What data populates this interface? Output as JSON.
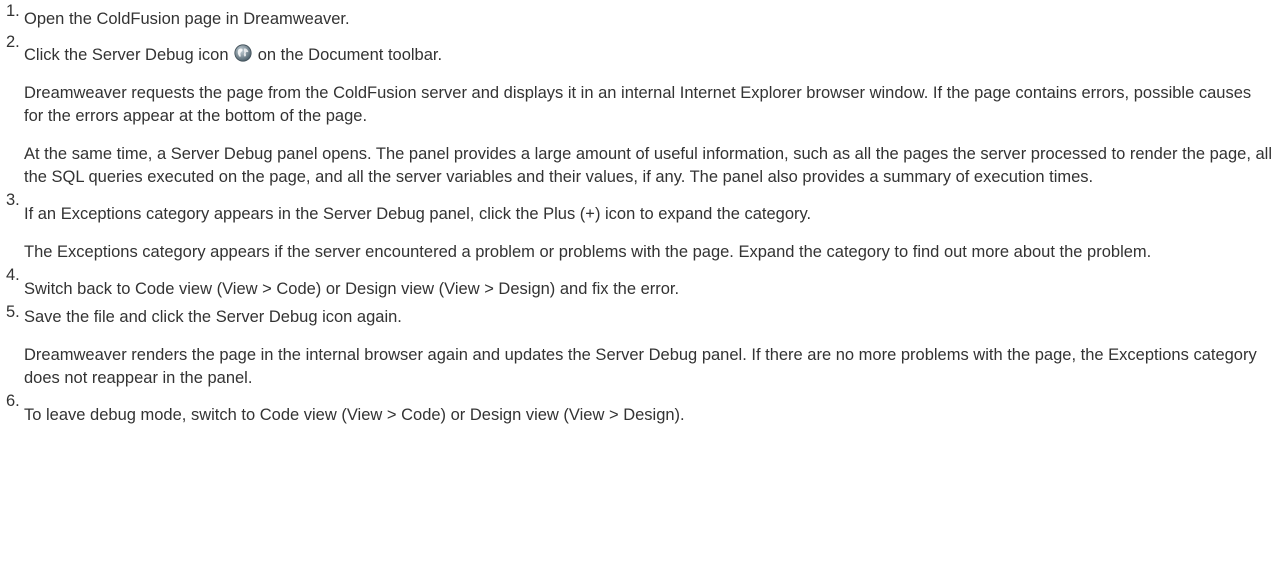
{
  "steps": [
    {
      "number": "1.",
      "text": "Open the ColdFusion page in Dreamweaver."
    },
    {
      "number": "2.",
      "text_before_icon": "Click the Server Debug icon",
      "icon": "server-debug-globe-icon",
      "text_after_icon": "on the Document toolbar.",
      "paragraphs": [
        "Dreamweaver requests the page from the ColdFusion server and displays it in an internal Internet Explorer browser window. If the page contains errors, possible causes for the errors appear at the bottom of the page.",
        "At the same time, a Server Debug panel opens. The panel provides a large amount of useful information, such as all the pages the server processed to render the page, all the SQL queries executed on the page, and all the server variables and their values, if any. The panel also provides a summary of execution times."
      ]
    },
    {
      "number": "3.",
      "text": "If an Exceptions category appears in the Server Debug panel, click the Plus (+) icon to expand the category.",
      "paragraphs": [
        "The Exceptions category appears if the server encountered a problem or problems with the page. Expand the category to find out more about the problem."
      ]
    },
    {
      "number": "4.",
      "text": "Switch back to Code view (View > Code) or Design view (View > Design) and fix the error."
    },
    {
      "number": "5.",
      "text": "Save the file and click the Server Debug icon again.",
      "paragraphs": [
        "Dreamweaver renders the page in the internal browser again and updates the Server Debug panel. If there are no more problems with the page, the Exceptions category does not reappear in the panel."
      ]
    },
    {
      "number": "6.",
      "text": "To leave debug mode, switch to Code view (View > Code) or Design view (View > Design)."
    }
  ],
  "colors": {
    "text": "#333333",
    "background": "#ffffff",
    "icon_globe": "#6a7f8c"
  }
}
